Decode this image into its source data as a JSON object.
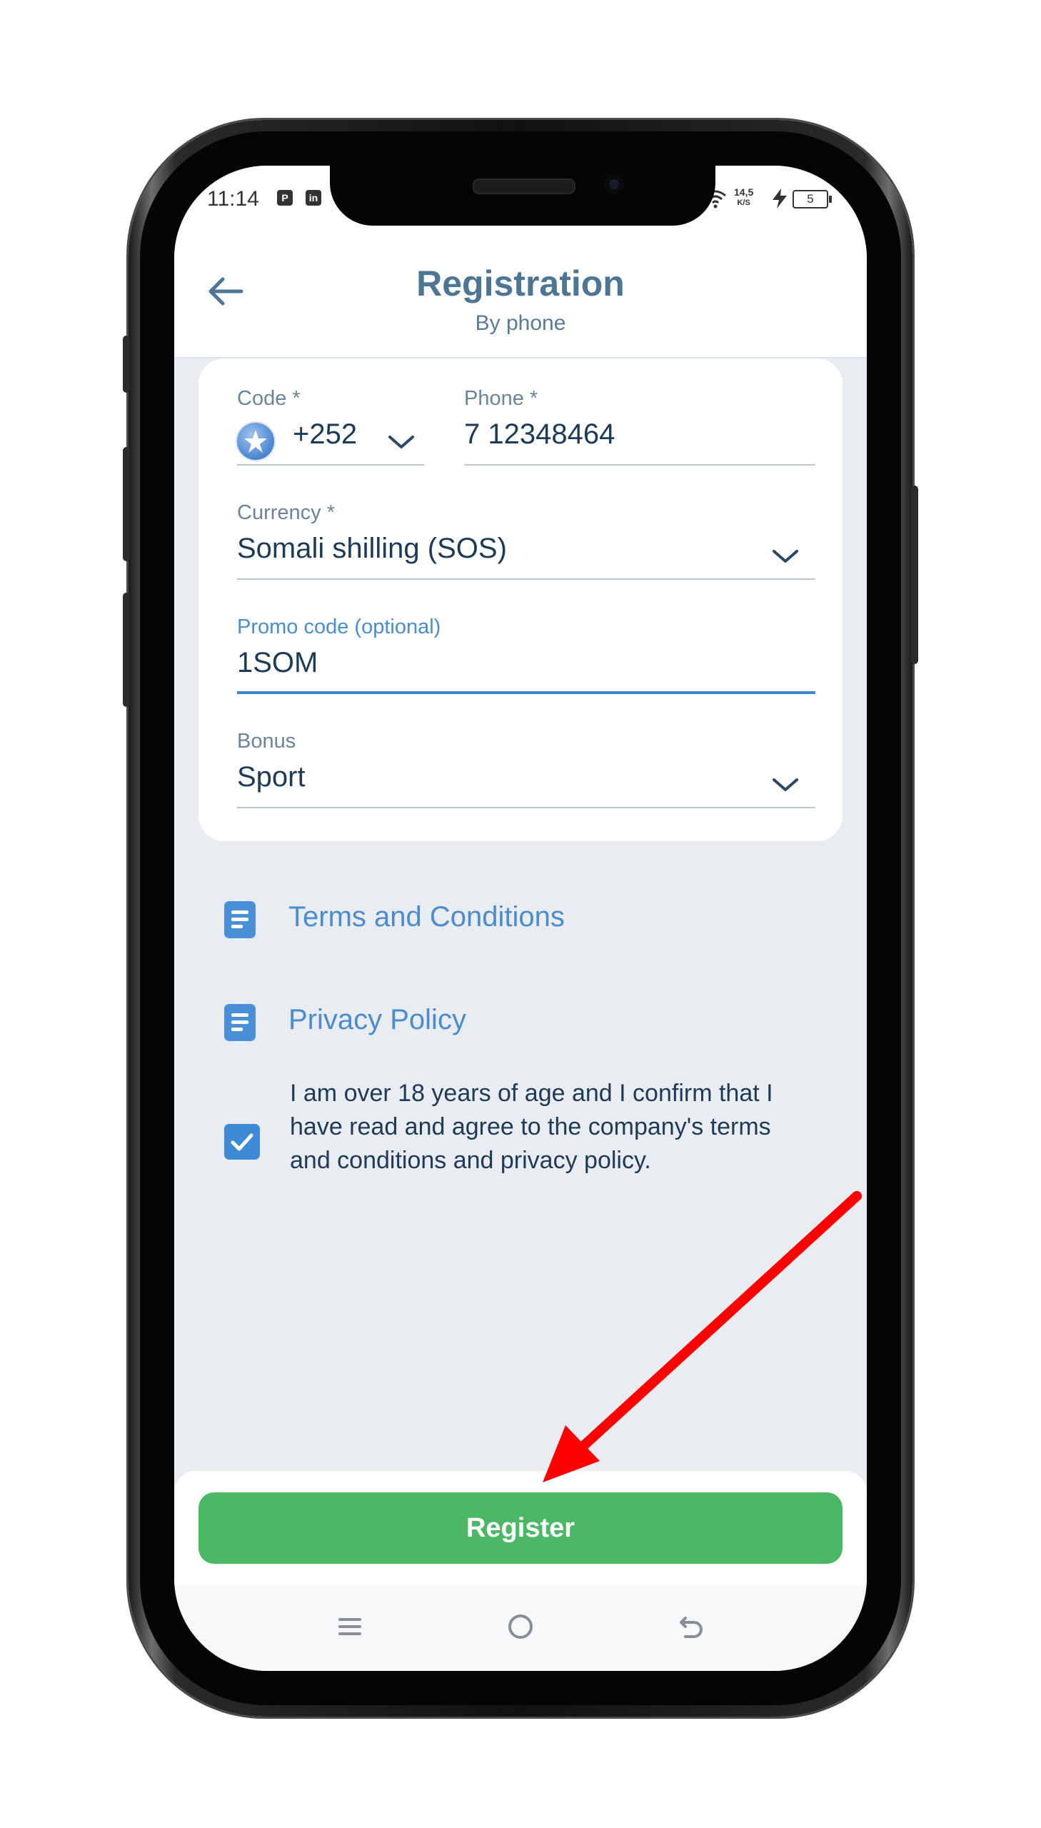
{
  "status_bar": {
    "time": "11:14",
    "net_speed_value": "14,5",
    "net_speed_unit": "K/S",
    "battery": "5"
  },
  "header": {
    "title": "Registration",
    "subtitle": "By phone"
  },
  "form": {
    "code": {
      "label": "Code *",
      "value": "+252"
    },
    "phone": {
      "label": "Phone *",
      "value": "7 12348464"
    },
    "currency": {
      "label": "Currency *",
      "value": "Somali shilling (SOS)"
    },
    "promo": {
      "label": "Promo code (optional)",
      "value": "1SOM"
    },
    "bonus": {
      "label": "Bonus",
      "value": "Sport"
    }
  },
  "links": {
    "terms": "Terms and Conditions",
    "privacy": "Privacy Policy"
  },
  "consent": {
    "checked": true,
    "text": "I am over 18 years of age and I confirm that I have read and agree to the company's terms and conditions and privacy policy."
  },
  "register_label": "Register",
  "colors": {
    "accent_blue": "#3f86cf",
    "register_green": "#4cb866",
    "annotation_arrow": "#ff0000"
  }
}
